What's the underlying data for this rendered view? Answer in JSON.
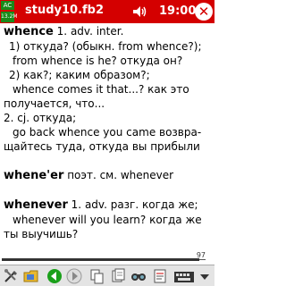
{
  "titlebar": {
    "ac_label": "AC",
    "memory": "13.2M",
    "title": "study10.fb2",
    "time": "19:00",
    "close_label": "✕"
  },
  "content": {
    "lines": [
      {
        "hw": "whence",
        "text": " 1. adv. inter."
      },
      {
        "text": "1) откуда? (обыкн. from whence?);"
      },
      {
        "text": "from whence is he? откуда он?"
      },
      {
        "text": "2) как?; каким образом?;"
      },
      {
        "text": "whence comes it that...? как это"
      },
      {
        "text": "получается, что..."
      },
      {
        "text": "2. cj. откуда;"
      },
      {
        "text": "go back whence you came возвра-"
      },
      {
        "text": "щайтесь туда, откуда вы прибыли"
      },
      {
        "text": ""
      },
      {
        "hw": "whene'er",
        "text": "  поэт. см. whenever"
      },
      {
        "text": ""
      },
      {
        "hw": "whenever",
        "text": " 1. adv. разг. когда же;"
      },
      {
        "text": "whenever will you learn? когда же"
      },
      {
        "text": "ты выучишь?"
      }
    ]
  },
  "progress": {
    "page_label": "97",
    "fraction": 0.97
  },
  "toolbar": {
    "items": [
      "tools-icon",
      "folder-icon",
      "back-icon",
      "forward-icon",
      "copy-icon",
      "find-icon",
      "bookmark-icon",
      "keyboard-icon"
    ]
  }
}
